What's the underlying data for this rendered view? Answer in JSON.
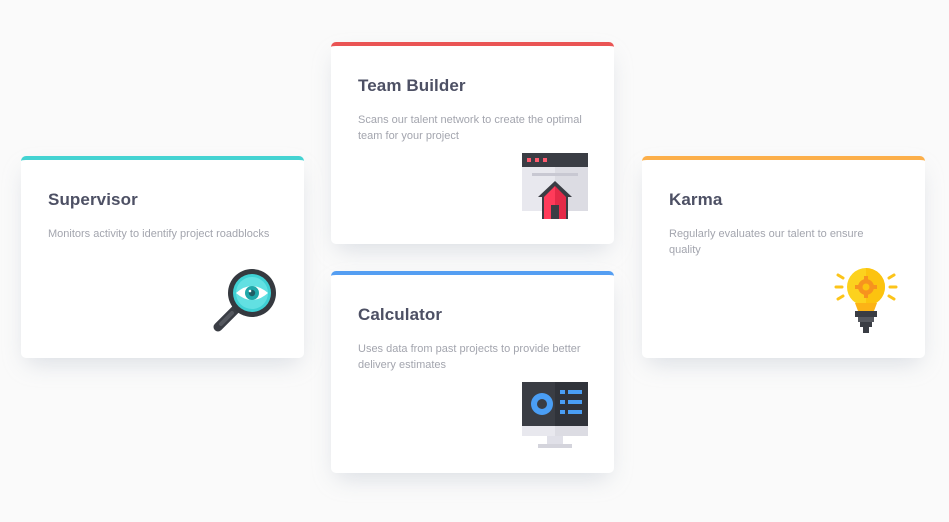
{
  "cards": [
    {
      "id": "supervisor",
      "title": "Supervisor",
      "description": "Monitors activity to identify project roadblocks",
      "accent": "#44d3d2",
      "icon": "magnifier-eye-icon"
    },
    {
      "id": "team_builder",
      "title": "Team Builder",
      "description": "Scans our talent network to create the optimal team for your project",
      "accent": "#ea5454",
      "icon": "browser-house-icon"
    },
    {
      "id": "calculator",
      "title": "Calculator",
      "description": "Uses data from past projects to provide better delivery estimates",
      "accent": "#549ef2",
      "icon": "monitor-chart-icon"
    },
    {
      "id": "karma",
      "title": "Karma",
      "description": "Regularly evaluates our talent to ensure quality",
      "accent": "#fcaf4a",
      "icon": "lightbulb-icon"
    }
  ]
}
